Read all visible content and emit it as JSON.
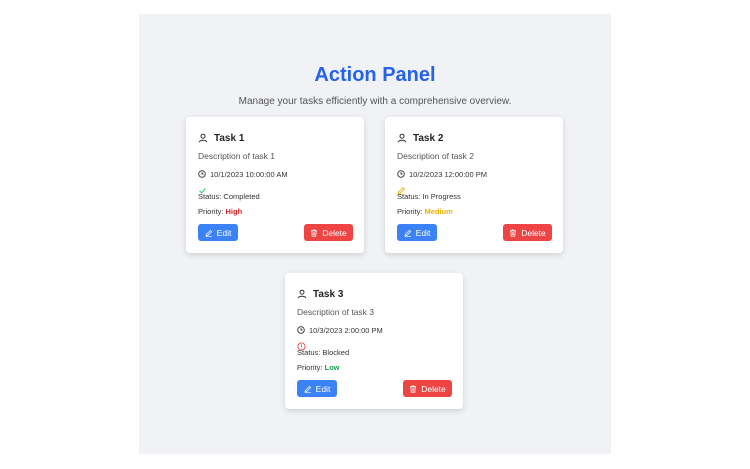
{
  "header": {
    "title": "Action Panel",
    "subtitle": "Manage your tasks efficiently with a comprehensive overview."
  },
  "tasks": [
    {
      "title": "Task 1",
      "description": "Description of task 1",
      "datetime": "10/1/2023 10:00:00 AM",
      "status_icon": "check-icon",
      "status_color": "#22c55e",
      "status": "Status: Completed",
      "priority_label": "Priority: ",
      "priority": "High",
      "priority_color": "#dc2626",
      "edit_label": "Edit",
      "delete_label": "Delete"
    },
    {
      "title": "Task 2",
      "description": "Description of task 2",
      "datetime": "10/2/2023 12:00:00 PM",
      "status_icon": "pencil-icon",
      "status_color": "#eab308",
      "status": "Status: In Progress",
      "priority_label": "Priority: ",
      "priority": "Medium",
      "priority_color": "#eab308",
      "edit_label": "Edit",
      "delete_label": "Delete"
    },
    {
      "title": "Task 3",
      "description": "Description of task 3",
      "datetime": "10/3/2023 2:00:00 PM",
      "status_icon": "alert-circle-icon",
      "status_color": "#ef4444",
      "status": "Status: Blocked",
      "priority_label": "Priority: ",
      "priority": "Low",
      "priority_color": "#16a34a",
      "edit_label": "Edit",
      "delete_label": "Delete"
    }
  ],
  "colors": {
    "accent": "#2563eb",
    "edit_button": "#3b82f6",
    "delete_button": "#ef4444",
    "panel_background": "#f0f2f5"
  }
}
